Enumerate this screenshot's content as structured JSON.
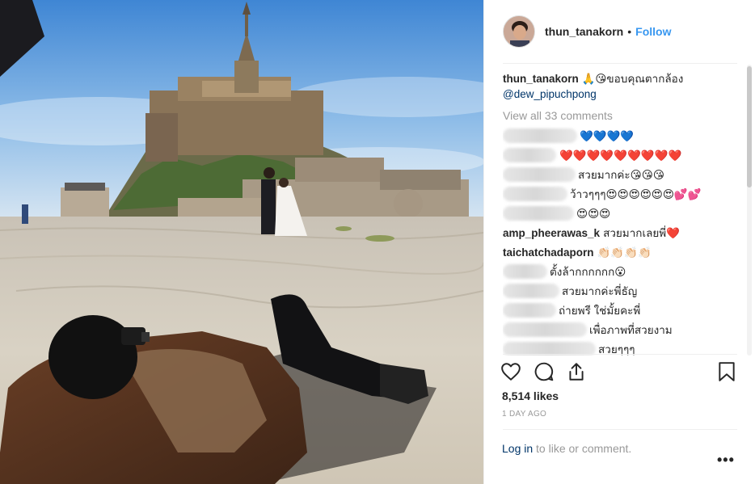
{
  "header": {
    "username": "thun_tanakorn",
    "separator": "•",
    "follow_label": "Follow"
  },
  "caption": {
    "username": "thun_tanakorn",
    "text": "🙏😘ขอบคุณตากล้อง",
    "mention": "@dew_pipuchpong"
  },
  "view_all_label": "View all 33 comments",
  "comments": [
    {
      "user": "",
      "text": "💙💙💙💙"
    },
    {
      "user": "",
      "text": "❤️❤️❤️❤️❤️❤️❤️❤️❤️"
    },
    {
      "user": "",
      "text": "สวยมากค่ะ😘😘😘"
    },
    {
      "user": "",
      "text": "ว้าวๆๆๆ😍😍😍😍😍😍💕💕"
    },
    {
      "user": "",
      "text": "😍😍😍"
    },
    {
      "user": "amp_pheerawas_k",
      "text": "สวยมากเลยพี่❤️"
    },
    {
      "user": "taichatchadaporn",
      "text": "👏🏻👏🏻👏🏻👏🏻"
    },
    {
      "user": "",
      "text": "ตั้งล้ากกกกกก😮"
    },
    {
      "user": "",
      "text": "สวยมากค่ะพี่ธัญ"
    },
    {
      "user": "",
      "text": "ถ่ายพรี ใช่มั้ยคะพี่"
    },
    {
      "user": "",
      "text": "เพื่อภาพที่สวยงาม"
    },
    {
      "user": "",
      "text": "สวยๆๆๆ"
    }
  ],
  "likes": "8,514 likes",
  "timestamp": "1 DAY AGO",
  "login": {
    "link": "Log in",
    "text": " to like or comment."
  },
  "more_label": "•••",
  "icons": [
    "heart-icon",
    "comment-icon",
    "share-icon",
    "bookmark-icon",
    "more-options-icon"
  ],
  "colors": {
    "accent": "#3897f0",
    "link": "#003569",
    "muted": "#999999",
    "text": "#262626"
  }
}
